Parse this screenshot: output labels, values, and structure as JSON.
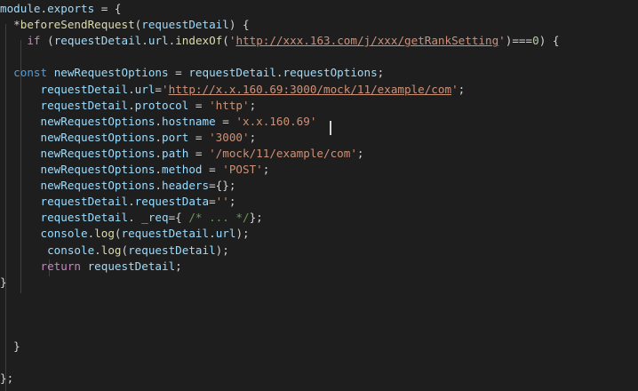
{
  "colors": {
    "background": "#1e1e1e",
    "plain": "#d4d4d4",
    "variable": "#9cdcfe",
    "function": "#dcdcaa",
    "keyword_control": "#c586c0",
    "keyword_storage": "#569cd6",
    "string": "#ce9178",
    "number": "#b5cea8",
    "comment": "#6a9955"
  },
  "editor": {
    "lines": [
      [
        {
          "t": "module",
          "k": "var"
        },
        {
          "t": ".",
          "k": "plain"
        },
        {
          "t": "exports",
          "k": "var"
        },
        {
          "t": " = {",
          "k": "plain"
        }
      ],
      [
        {
          "t": "  *",
          "k": "plain"
        },
        {
          "t": "beforeSendRequest",
          "k": "func"
        },
        {
          "t": "(",
          "k": "plain"
        },
        {
          "t": "requestDetail",
          "k": "var"
        },
        {
          "t": ") {",
          "k": "plain"
        }
      ],
      [
        {
          "t": "    ",
          "k": "plain"
        },
        {
          "t": "if",
          "k": "keyword"
        },
        {
          "t": " (",
          "k": "plain"
        },
        {
          "t": "requestDetail",
          "k": "var"
        },
        {
          "t": ".",
          "k": "plain"
        },
        {
          "t": "url",
          "k": "var"
        },
        {
          "t": ".",
          "k": "plain"
        },
        {
          "t": "indexOf",
          "k": "func"
        },
        {
          "t": "(",
          "k": "plain"
        },
        {
          "t": "'",
          "k": "string"
        },
        {
          "t": "http://xxx.163.com/j/xxx/getRankSetting",
          "k": "url"
        },
        {
          "t": "'",
          "k": "string"
        },
        {
          "t": ")===",
          "k": "plain"
        },
        {
          "t": "0",
          "k": "number"
        },
        {
          "t": ") {",
          "k": "plain"
        }
      ],
      [],
      [
        {
          "t": "  ",
          "k": "plain"
        },
        {
          "t": "const",
          "k": "storage"
        },
        {
          "t": " ",
          "k": "plain"
        },
        {
          "t": "newRequestOptions",
          "k": "var"
        },
        {
          "t": " = ",
          "k": "plain"
        },
        {
          "t": "requestDetail",
          "k": "var"
        },
        {
          "t": ".",
          "k": "plain"
        },
        {
          "t": "requestOptions",
          "k": "var"
        },
        {
          "t": ";",
          "k": "plain"
        }
      ],
      [
        {
          "t": "      ",
          "k": "plain"
        },
        {
          "t": "requestDetail",
          "k": "var"
        },
        {
          "t": ".",
          "k": "plain"
        },
        {
          "t": "url",
          "k": "var"
        },
        {
          "t": "=",
          "k": "plain"
        },
        {
          "t": "'",
          "k": "string"
        },
        {
          "t": "http://x.x.160.69:3000/mock/11/example/com",
          "k": "url"
        },
        {
          "t": "'",
          "k": "string"
        },
        {
          "t": ";",
          "k": "plain"
        }
      ],
      [
        {
          "t": "      ",
          "k": "plain"
        },
        {
          "t": "requestDetail",
          "k": "var"
        },
        {
          "t": ".",
          "k": "plain"
        },
        {
          "t": "protocol",
          "k": "var"
        },
        {
          "t": " = ",
          "k": "plain"
        },
        {
          "t": "'http'",
          "k": "string"
        },
        {
          "t": ";",
          "k": "plain"
        }
      ],
      [
        {
          "t": "      ",
          "k": "plain"
        },
        {
          "t": "newRequestOptions",
          "k": "var"
        },
        {
          "t": ".",
          "k": "plain"
        },
        {
          "t": "hostname",
          "k": "var"
        },
        {
          "t": " = ",
          "k": "plain"
        },
        {
          "t": "'x.x.160.69'",
          "k": "string"
        }
      ],
      [
        {
          "t": "      ",
          "k": "plain"
        },
        {
          "t": "newRequestOptions",
          "k": "var"
        },
        {
          "t": ".",
          "k": "plain"
        },
        {
          "t": "port",
          "k": "var"
        },
        {
          "t": " = ",
          "k": "plain"
        },
        {
          "t": "'3000'",
          "k": "string"
        },
        {
          "t": ";",
          "k": "plain"
        }
      ],
      [
        {
          "t": "      ",
          "k": "plain"
        },
        {
          "t": "newRequestOptions",
          "k": "var"
        },
        {
          "t": ".",
          "k": "plain"
        },
        {
          "t": "path",
          "k": "var"
        },
        {
          "t": " = ",
          "k": "plain"
        },
        {
          "t": "'/mock/11/example/com'",
          "k": "string"
        },
        {
          "t": ";",
          "k": "plain"
        }
      ],
      [
        {
          "t": "      ",
          "k": "plain"
        },
        {
          "t": "newRequestOptions",
          "k": "var"
        },
        {
          "t": ".",
          "k": "plain"
        },
        {
          "t": "method",
          "k": "var"
        },
        {
          "t": " = ",
          "k": "plain"
        },
        {
          "t": "'POST'",
          "k": "string"
        },
        {
          "t": ";",
          "k": "plain"
        }
      ],
      [
        {
          "t": "      ",
          "k": "plain"
        },
        {
          "t": "newRequestOptions",
          "k": "var"
        },
        {
          "t": ".",
          "k": "plain"
        },
        {
          "t": "headers",
          "k": "var"
        },
        {
          "t": "={};",
          "k": "plain"
        }
      ],
      [
        {
          "t": "      ",
          "k": "plain"
        },
        {
          "t": "requestDetail",
          "k": "var"
        },
        {
          "t": ".",
          "k": "plain"
        },
        {
          "t": "requestData",
          "k": "var"
        },
        {
          "t": "=",
          "k": "plain"
        },
        {
          "t": "''",
          "k": "string"
        },
        {
          "t": ";",
          "k": "plain"
        }
      ],
      [
        {
          "t": "      ",
          "k": "plain"
        },
        {
          "t": "requestDetail",
          "k": "var"
        },
        {
          "t": ". ",
          "k": "plain"
        },
        {
          "t": "_req",
          "k": "var"
        },
        {
          "t": "={ ",
          "k": "plain"
        },
        {
          "t": "/* ... */",
          "k": "comment"
        },
        {
          "t": "};",
          "k": "plain"
        }
      ],
      [
        {
          "t": "      ",
          "k": "plain"
        },
        {
          "t": "console",
          "k": "var"
        },
        {
          "t": ".",
          "k": "plain"
        },
        {
          "t": "log",
          "k": "func"
        },
        {
          "t": "(",
          "k": "plain"
        },
        {
          "t": "requestDetail",
          "k": "var"
        },
        {
          "t": ".",
          "k": "plain"
        },
        {
          "t": "url",
          "k": "var"
        },
        {
          "t": ");",
          "k": "plain"
        }
      ],
      [
        {
          "t": "       ",
          "k": "plain"
        },
        {
          "t": "console",
          "k": "var"
        },
        {
          "t": ".",
          "k": "plain"
        },
        {
          "t": "log",
          "k": "func"
        },
        {
          "t": "(",
          "k": "plain"
        },
        {
          "t": "requestDetail",
          "k": "var"
        },
        {
          "t": ");",
          "k": "plain"
        }
      ],
      [
        {
          "t": "      ",
          "k": "plain"
        },
        {
          "t": "return",
          "k": "keyword"
        },
        {
          "t": " ",
          "k": "plain"
        },
        {
          "t": "requestDetail",
          "k": "var"
        },
        {
          "t": ";",
          "k": "plain"
        }
      ],
      [
        {
          "t": "}",
          "k": "plain"
        }
      ],
      [],
      [],
      [],
      [
        {
          "t": "  }",
          "k": "plain"
        }
      ],
      [],
      [
        {
          "t": "};",
          "k": "plain"
        }
      ]
    ]
  }
}
